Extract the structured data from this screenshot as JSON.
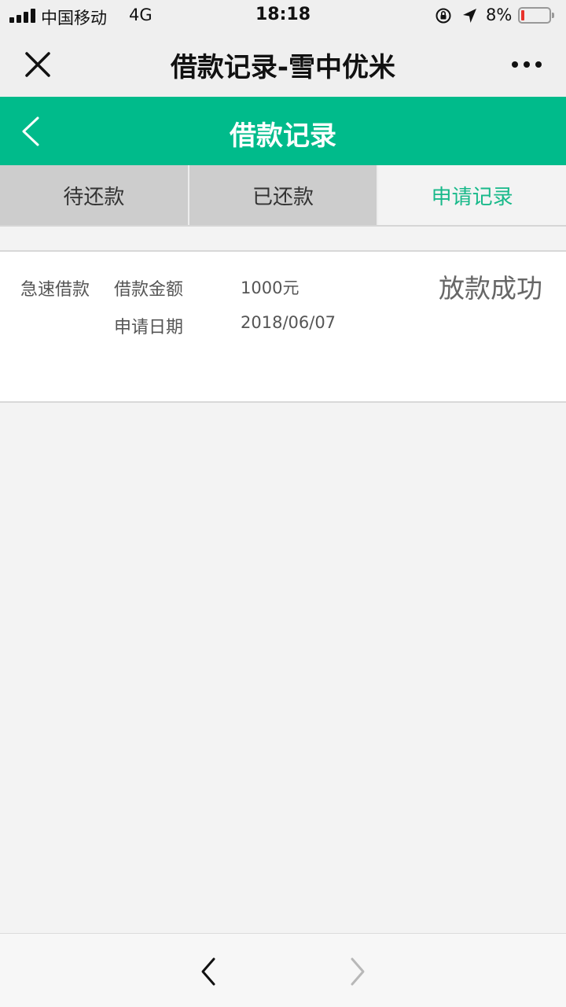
{
  "status_bar": {
    "carrier": "中国移动",
    "network": "4G",
    "time": "18:18",
    "battery_percent": "8%",
    "battery_level": 0.08
  },
  "nav": {
    "title": "借款记录-雪中优米"
  },
  "header": {
    "title": "借款记录",
    "accent_color": "#00bb8b"
  },
  "tabs": [
    {
      "label": "待还款",
      "active": false
    },
    {
      "label": "已还款",
      "active": false
    },
    {
      "label": "申请记录",
      "active": true
    }
  ],
  "record": {
    "type": "急速借款",
    "amount_label": "借款金额",
    "amount_value": "1000元",
    "date_label": "申请日期",
    "date_value": "2018/06/07",
    "status": "放款成功"
  },
  "icons": {
    "close": "close-icon",
    "more": "more-icon",
    "back": "chevron-left-icon",
    "browser_back": "chevron-left-icon",
    "browser_forward": "chevron-right-icon"
  }
}
